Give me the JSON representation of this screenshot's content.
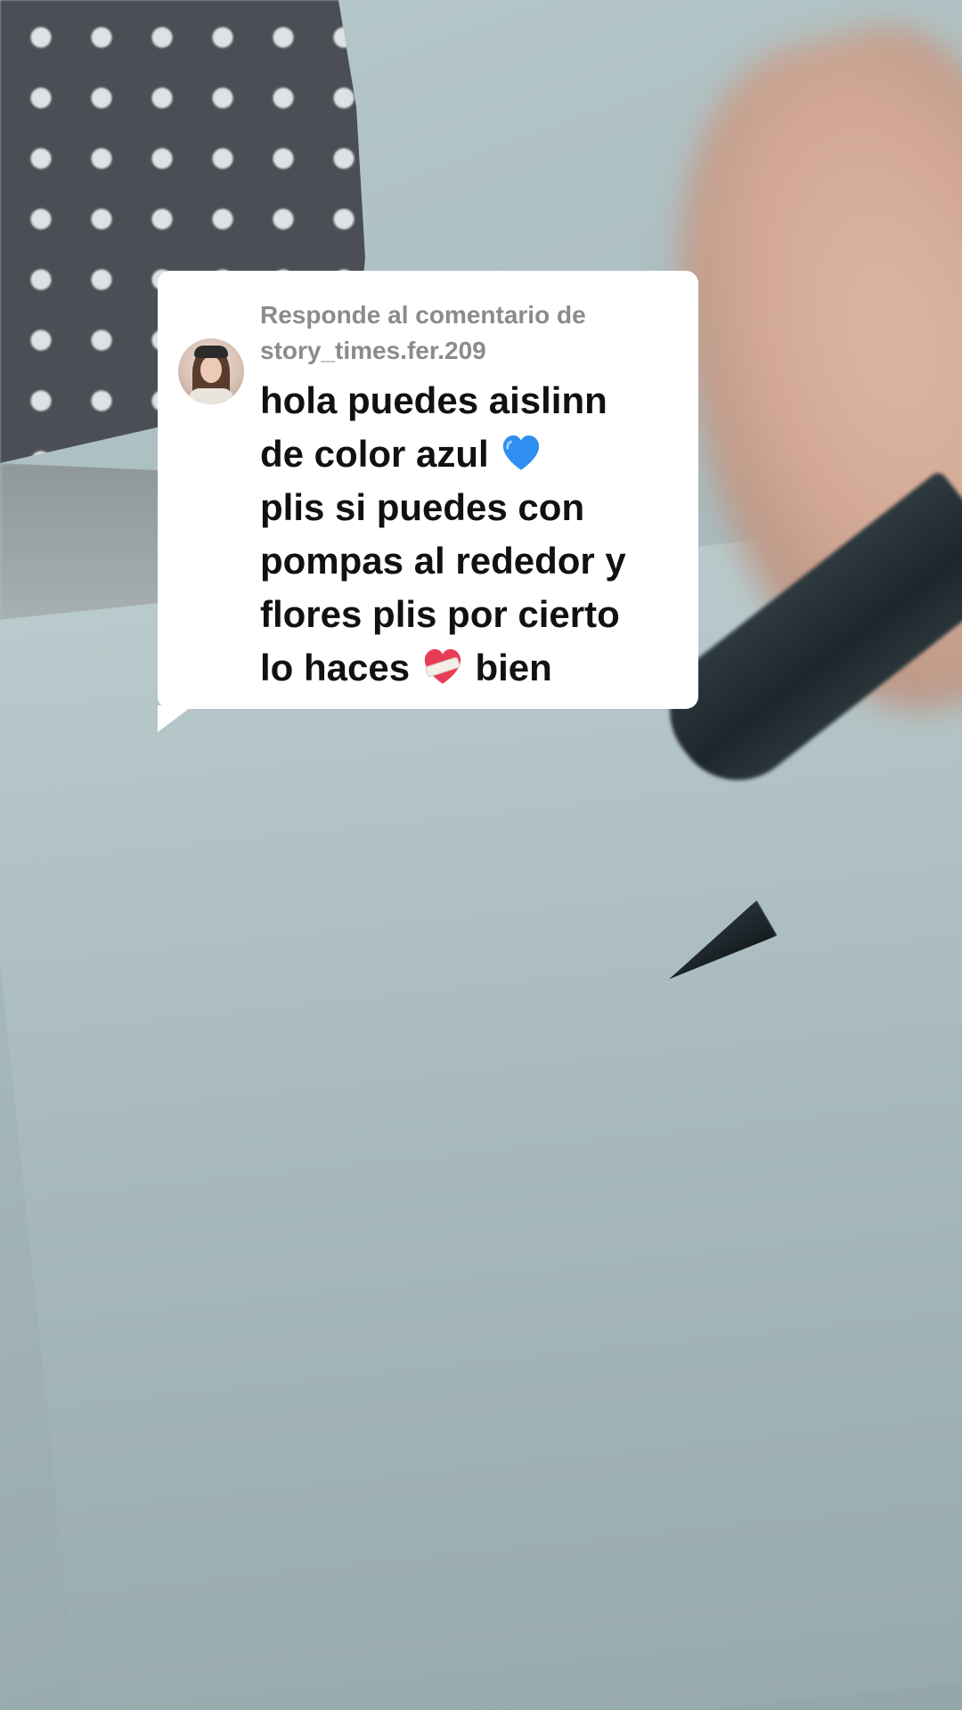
{
  "reply": {
    "header_prefix": "Responde al comentario de",
    "username": "story_times.fer.209"
  },
  "comment": {
    "line1": "hola puedes aislinn",
    "line2_text": "de color azul",
    "line2_emoji": "blue-heart-icon",
    "line3": "plis si puedes con",
    "line4": "pompas al rededor y",
    "line5": "flores plis por cierto",
    "line6_before": "lo haces",
    "line6_emoji": "mending-heart-icon",
    "line6_after": "bien"
  },
  "colors": {
    "bubble": "#ffffff",
    "header_text": "#8a8b8f",
    "comment_text": "#111111",
    "blue_heart": "#2f8ff0",
    "red_heart": "#e83b55"
  }
}
